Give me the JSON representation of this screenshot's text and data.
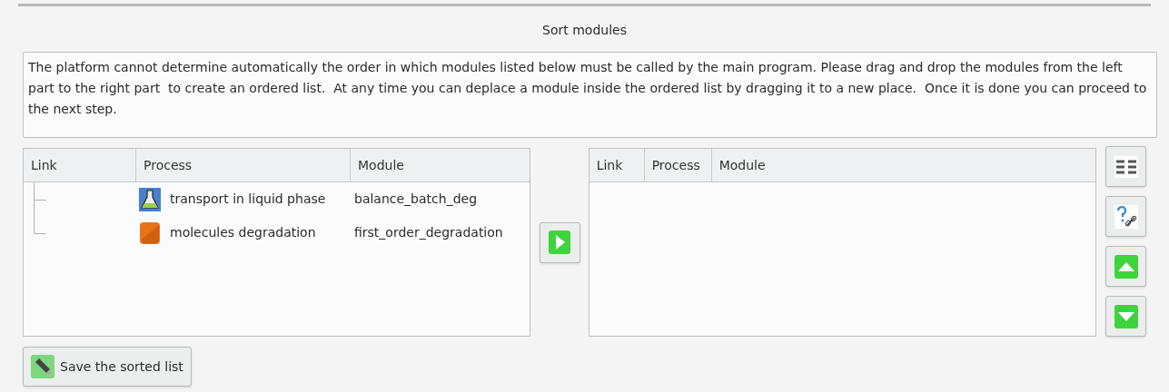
{
  "title": "Sort modules",
  "instructions": "The platform cannot determine automatically the order in which modules listed below must be called by the main program. Please drag and drop the modules from the left part to the right part  to create an ordered list.  At any time you can deplace a module inside the ordered list by dragging it to a new place.  Once it is done you can proceed to the next step.",
  "left_table": {
    "columns": [
      "Link",
      "Process",
      "Module"
    ],
    "rows": [
      {
        "process": "transport in liquid phase",
        "module": "balance_batch_deg",
        "kind": "flask"
      },
      {
        "process": "molecules degradation",
        "module": "first_order_degradation",
        "kind": "box"
      }
    ]
  },
  "right_table": {
    "columns": [
      "Link",
      "Process",
      "Module"
    ]
  },
  "save_button": "Save the sorted list"
}
